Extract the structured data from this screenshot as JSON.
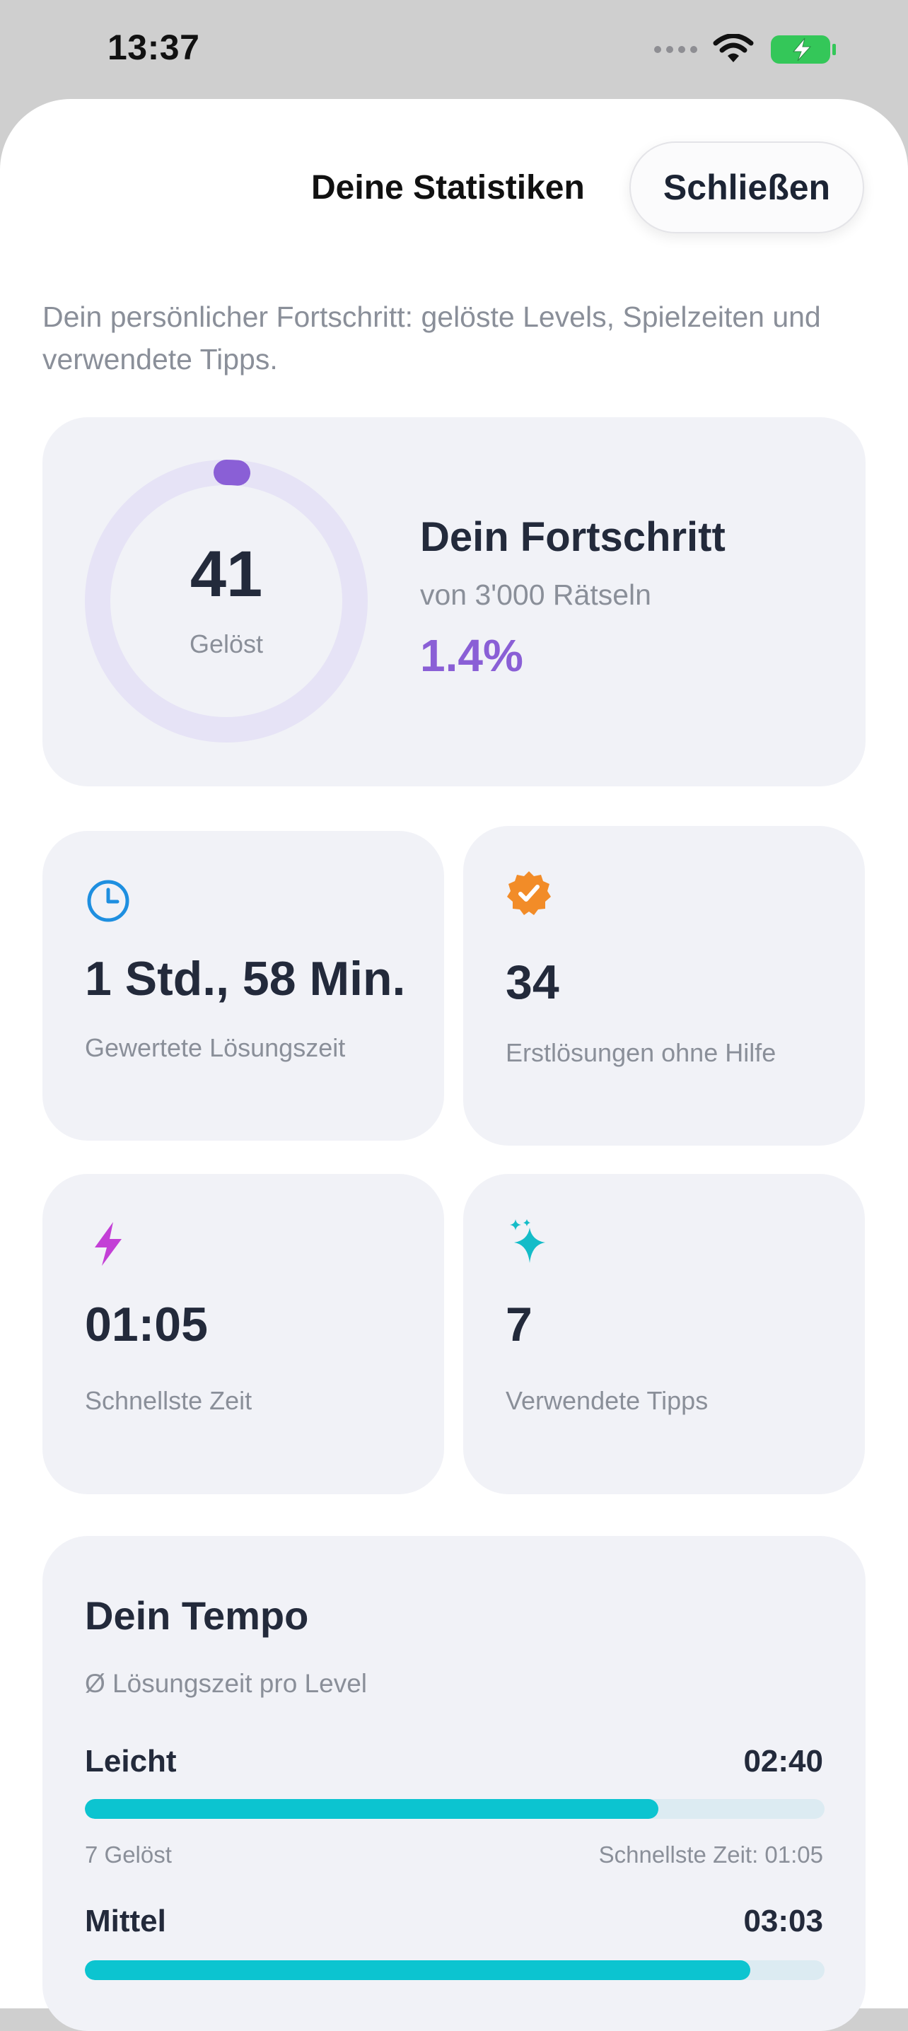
{
  "status_bar": {
    "time": "13:37"
  },
  "header": {
    "title": "Deine Statistiken",
    "close_label": "Schließen"
  },
  "intro": "Dein persönlicher Fortschritt: gelöste Levels, Spielzeiten und verwendete Tipps.",
  "progress": {
    "solved_count": "41",
    "solved_label": "Gelöst",
    "title": "Dein Fortschritt",
    "subtitle": "von 3'000 Rätseln",
    "percent_text": "1.4%",
    "fraction": 0.014,
    "accent": "#8a5fd6"
  },
  "stats": [
    {
      "icon": "clock-icon",
      "value": "1 Std., 58 Min.",
      "label": "Gewertete Lösungszeit",
      "color": "#1e8fe0"
    },
    {
      "icon": "verified-badge-icon",
      "value": "34",
      "label": "Erstlösungen ohne Hilfe",
      "color": "#f28c28"
    },
    {
      "icon": "lightning-icon",
      "value": "01:05",
      "label": "Schnellste Zeit",
      "color": "#c33fd6"
    },
    {
      "icon": "sparkles-icon",
      "value": "7",
      "label": "Verwendete Tipps",
      "color": "#14bcc8"
    }
  ],
  "tempo": {
    "title": "Dein Tempo",
    "subtitle": "Ø Lösungszeit pro Level",
    "rows": [
      {
        "name": "Leicht",
        "time": "02:40",
        "solved": "7 Gelöst",
        "fastest": "Schnellste Zeit: 01:05",
        "fill": 0.775
      },
      {
        "name": "Mittel",
        "time": "03:03",
        "solved": "",
        "fastest": "",
        "fill": 0.9
      }
    ]
  }
}
